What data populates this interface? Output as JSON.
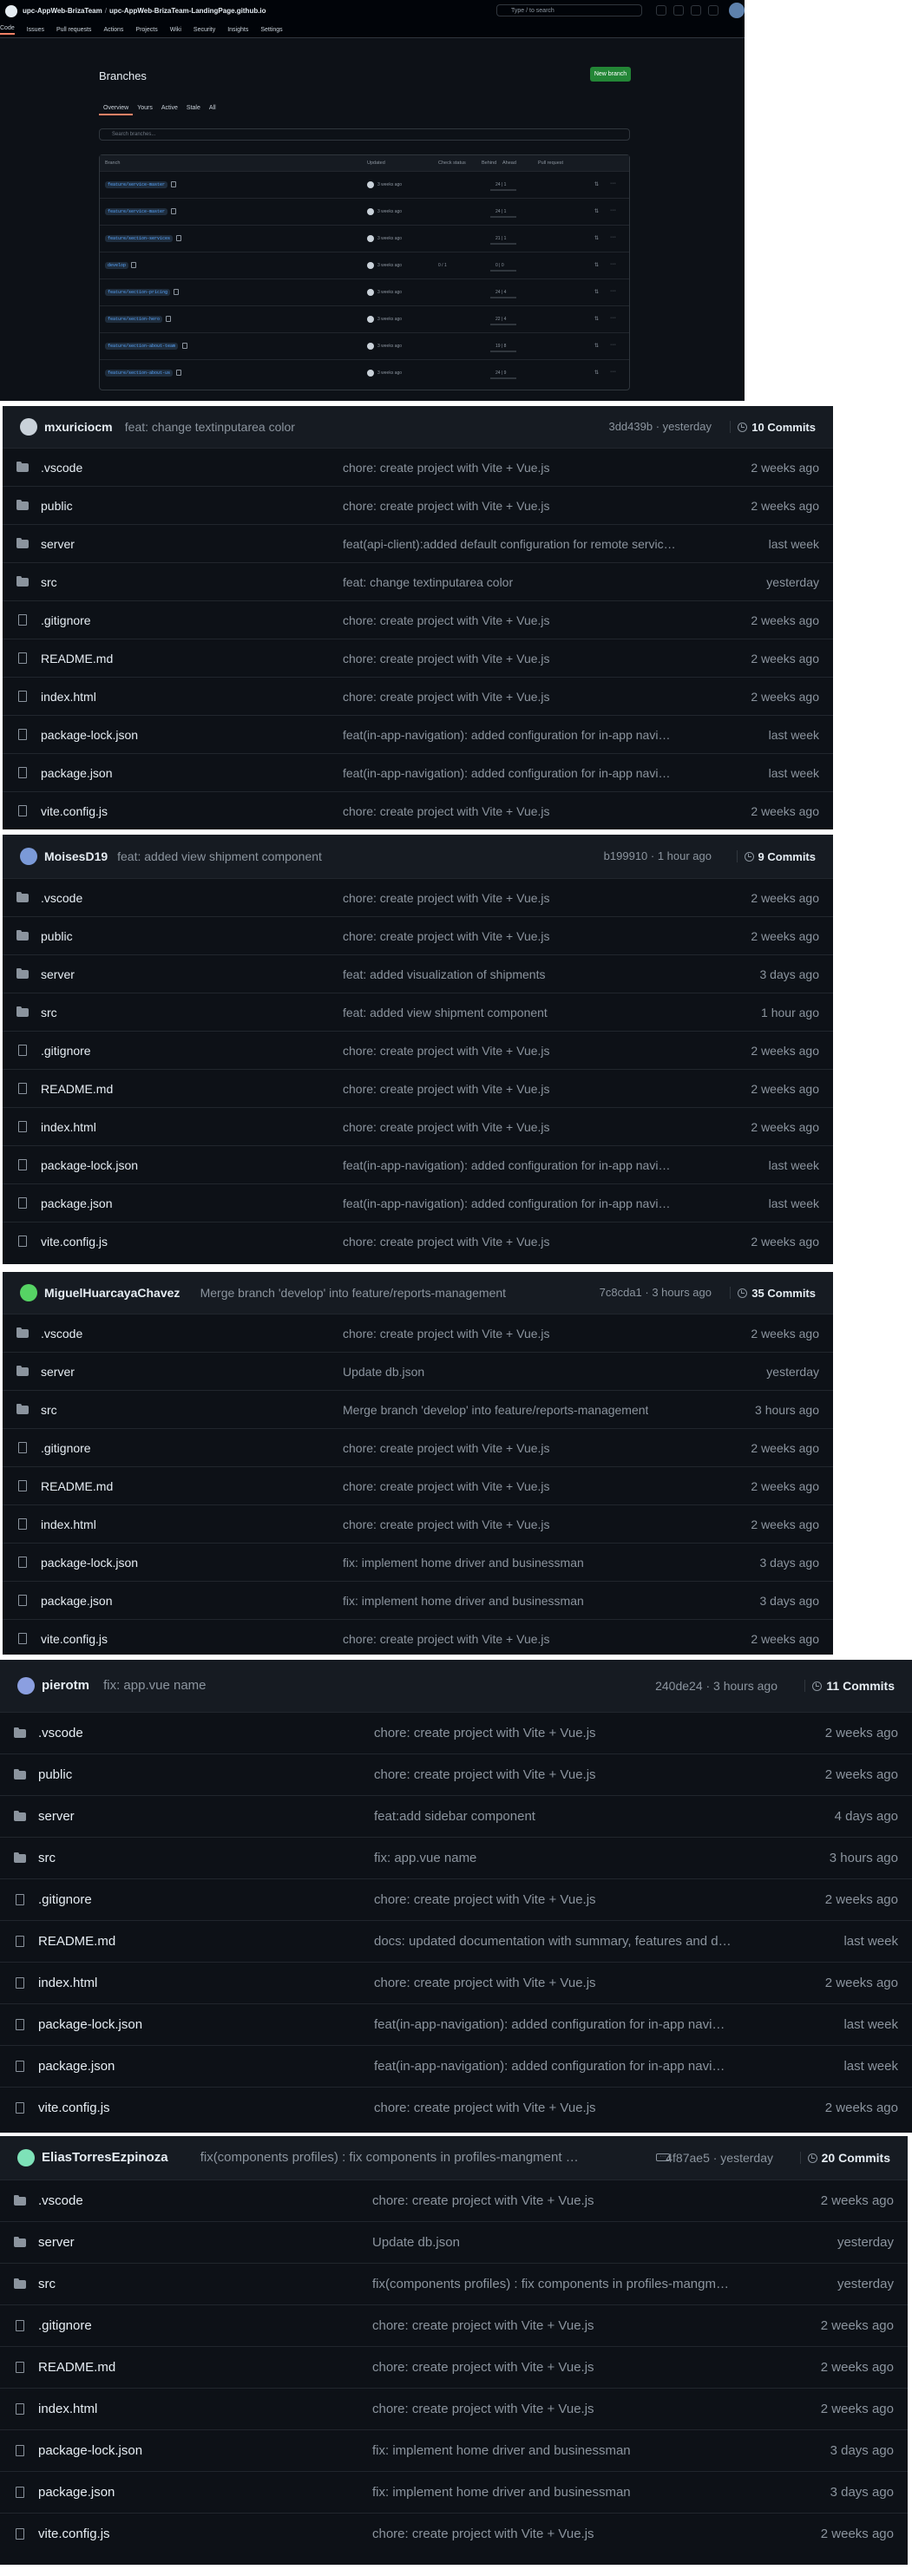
{
  "branches_page": {
    "repo_owner": "upc-AppWeb-BrizaTeam",
    "separator": "/",
    "repo_name": "upc-AppWeb-BrizaTeam-LandingPage.github.io",
    "search_placeholder": "Type / to search",
    "nav": [
      "Code",
      "Issues",
      "Pull requests",
      "Actions",
      "Projects",
      "Wiki",
      "Security",
      "Insights",
      "Settings"
    ],
    "title": "Branches",
    "new_branch_label": "New branch",
    "tabs": [
      "Overview",
      "Yours",
      "Active",
      "Stale",
      "All"
    ],
    "filter_placeholder": "Search branches...",
    "columns": [
      "Branch",
      "Updated",
      "Check status",
      "Behind",
      "Ahead",
      "Pull request"
    ],
    "rows": [
      {
        "name": "feature/service-master",
        "updated": "3 weeks ago",
        "checks": "",
        "ab": "24 | 1"
      },
      {
        "name": "feature/service-master",
        "updated": "3 weeks ago",
        "checks": "",
        "ab": "24 | 1"
      },
      {
        "name": "feature/section-services",
        "updated": "3 weeks ago",
        "checks": "",
        "ab": "21 | 1"
      },
      {
        "name": "develop",
        "updated": "3 weeks ago",
        "checks": "0 / 1",
        "ab": "0 | 0"
      },
      {
        "name": "feature/section-pricing",
        "updated": "3 weeks ago",
        "checks": "",
        "ab": "24 | 4"
      },
      {
        "name": "feature/section-hero",
        "updated": "3 weeks ago",
        "checks": "",
        "ab": "22 | 4"
      },
      {
        "name": "feature/section-about-team",
        "updated": "3 weeks ago",
        "checks": "",
        "ab": "19 | 8"
      },
      {
        "name": "feature/section-about-us",
        "updated": "3 weeks ago",
        "checks": "",
        "ab": "24 | 9"
      }
    ]
  },
  "panels": [
    {
      "author": "mxuriciocm",
      "message": "feat: change textinputarea color",
      "meta": "3dd439b · yesterday",
      "commits_label": "10 Commits",
      "avatar_color": "#c9d1d9",
      "rows": [
        {
          "type": "folder",
          "name": ".vscode",
          "commit": "chore: create project with Vite + Vue.js",
          "time": "2 weeks ago"
        },
        {
          "type": "folder",
          "name": "public",
          "commit": "chore: create project with Vite + Vue.js",
          "time": "2 weeks ago"
        },
        {
          "type": "folder",
          "name": "server",
          "commit": "feat(api-client):added default configuration for remote servic…",
          "time": "last week"
        },
        {
          "type": "folder",
          "name": "src",
          "commit": "feat: change textinputarea color",
          "time": "yesterday"
        },
        {
          "type": "file",
          "name": ".gitignore",
          "commit": "chore: create project with Vite + Vue.js",
          "time": "2 weeks ago"
        },
        {
          "type": "file",
          "name": "README.md",
          "commit": "chore: create project with Vite + Vue.js",
          "time": "2 weeks ago"
        },
        {
          "type": "file",
          "name": "index.html",
          "commit": "chore: create project with Vite + Vue.js",
          "time": "2 weeks ago"
        },
        {
          "type": "file",
          "name": "package-lock.json",
          "commit": "feat(in-app-navigation): added configuration for in-app navi…",
          "time": "last week"
        },
        {
          "type": "file",
          "name": "package.json",
          "commit": "feat(in-app-navigation): added configuration for in-app navi…",
          "time": "last week"
        },
        {
          "type": "file",
          "name": "vite.config.js",
          "commit": "chore: create project with Vite + Vue.js",
          "time": "2 weeks ago"
        }
      ]
    },
    {
      "author": "MoisesD19",
      "message": "feat: added view shipment component",
      "meta": "b199910 · 1 hour ago",
      "commits_label": "9 Commits",
      "avatar_color": "#7b9ad8",
      "rows": [
        {
          "type": "folder",
          "name": ".vscode",
          "commit": "chore: create project with Vite + Vue.js",
          "time": "2 weeks ago"
        },
        {
          "type": "folder",
          "name": "public",
          "commit": "chore: create project with Vite + Vue.js",
          "time": "2 weeks ago"
        },
        {
          "type": "folder",
          "name": "server",
          "commit": "feat: added visualization of shipments",
          "time": "3 days ago"
        },
        {
          "type": "folder",
          "name": "src",
          "commit": "feat: added view shipment component",
          "time": "1 hour ago"
        },
        {
          "type": "file",
          "name": ".gitignore",
          "commit": "chore: create project with Vite + Vue.js",
          "time": "2 weeks ago"
        },
        {
          "type": "file",
          "name": "README.md",
          "commit": "chore: create project with Vite + Vue.js",
          "time": "2 weeks ago"
        },
        {
          "type": "file",
          "name": "index.html",
          "commit": "chore: create project with Vite + Vue.js",
          "time": "2 weeks ago"
        },
        {
          "type": "file",
          "name": "package-lock.json",
          "commit": "feat(in-app-navigation): added configuration for in-app navi…",
          "time": "last week"
        },
        {
          "type": "file",
          "name": "package.json",
          "commit": "feat(in-app-navigation): added configuration for in-app navi…",
          "time": "last week"
        },
        {
          "type": "file",
          "name": "vite.config.js",
          "commit": "chore: create project with Vite + Vue.js",
          "time": "2 weeks ago"
        }
      ]
    },
    {
      "author": "MiguelHuarcayaChavez",
      "message": "Merge branch 'develop' into feature/reports-management",
      "meta": "7c8cda1 · 3 hours ago",
      "commits_label": "35 Commits",
      "avatar_color": "#56d364",
      "rows": [
        {
          "type": "folder",
          "name": ".vscode",
          "commit": "chore: create project with Vite + Vue.js",
          "time": "2 weeks ago"
        },
        {
          "type": "folder",
          "name": "server",
          "commit": "Update db.json",
          "time": "yesterday"
        },
        {
          "type": "folder",
          "name": "src",
          "commit": "Merge branch 'develop' into feature/reports-management",
          "time": "3 hours ago"
        },
        {
          "type": "file",
          "name": ".gitignore",
          "commit": "chore: create project with Vite + Vue.js",
          "time": "2 weeks ago"
        },
        {
          "type": "file",
          "name": "README.md",
          "commit": "chore: create project with Vite + Vue.js",
          "time": "2 weeks ago"
        },
        {
          "type": "file",
          "name": "index.html",
          "commit": "chore: create project with Vite + Vue.js",
          "time": "2 weeks ago"
        },
        {
          "type": "file",
          "name": "package-lock.json",
          "commit": "fix: implement home driver and businessman",
          "time": "3 days ago"
        },
        {
          "type": "file",
          "name": "package.json",
          "commit": "fix: implement home driver and businessman",
          "time": "3 days ago"
        },
        {
          "type": "file",
          "name": "vite.config.js",
          "commit": "chore: create project with Vite + Vue.js",
          "time": "2 weeks ago"
        }
      ]
    },
    {
      "author": "pierotm",
      "message": "fix: app.vue name",
      "meta": "240de24 · 3 hours ago",
      "commits_label": "11 Commits",
      "avatar_color": "#8b9fe0",
      "rows": [
        {
          "type": "folder",
          "name": ".vscode",
          "commit": "chore: create project with Vite + Vue.js",
          "time": "2 weeks ago"
        },
        {
          "type": "folder",
          "name": "public",
          "commit": "chore: create project with Vite + Vue.js",
          "time": "2 weeks ago"
        },
        {
          "type": "folder",
          "name": "server",
          "commit": "feat:add sidebar component",
          "time": "4 days ago"
        },
        {
          "type": "folder",
          "name": "src",
          "commit": "fix: app.vue name",
          "time": "3 hours ago"
        },
        {
          "type": "file",
          "name": ".gitignore",
          "commit": "chore: create project with Vite + Vue.js",
          "time": "2 weeks ago"
        },
        {
          "type": "file",
          "name": "README.md",
          "commit": "docs: updated documentation with summary, features and d…",
          "time": "last week"
        },
        {
          "type": "file",
          "name": "index.html",
          "commit": "chore: create project with Vite + Vue.js",
          "time": "2 weeks ago"
        },
        {
          "type": "file",
          "name": "package-lock.json",
          "commit": "feat(in-app-navigation): added configuration for in-app navi…",
          "time": "last week"
        },
        {
          "type": "file",
          "name": "package.json",
          "commit": "feat(in-app-navigation): added configuration for in-app navi…",
          "time": "last week"
        },
        {
          "type": "file",
          "name": "vite.config.js",
          "commit": "chore: create project with Vite + Vue.js",
          "time": "2 weeks ago"
        }
      ]
    },
    {
      "author": "EliasTorresEzpinoza",
      "message": "fix(components profiles) : fix components in profiles-mangment bou…",
      "meta": "4f87ae5 · yesterday",
      "commits_label": "20 Commits",
      "avatar_color": "#7ee2b8",
      "dots_label": "···",
      "rows": [
        {
          "type": "folder",
          "name": ".vscode",
          "commit": "chore: create project with Vite + Vue.js",
          "time": "2 weeks ago"
        },
        {
          "type": "folder",
          "name": "server",
          "commit": "Update db.json",
          "time": "yesterday"
        },
        {
          "type": "folder",
          "name": "src",
          "commit": "fix(components profiles) : fix components in profiles-mangm…",
          "time": "yesterday"
        },
        {
          "type": "file",
          "name": ".gitignore",
          "commit": "chore: create project with Vite + Vue.js",
          "time": "2 weeks ago"
        },
        {
          "type": "file",
          "name": "README.md",
          "commit": "chore: create project with Vite + Vue.js",
          "time": "2 weeks ago"
        },
        {
          "type": "file",
          "name": "index.html",
          "commit": "chore: create project with Vite + Vue.js",
          "time": "2 weeks ago"
        },
        {
          "type": "file",
          "name": "package-lock.json",
          "commit": "fix: implement home driver and businessman",
          "time": "3 days ago"
        },
        {
          "type": "file",
          "name": "package.json",
          "commit": "fix: implement home driver and businessman",
          "time": "3 days ago"
        },
        {
          "type": "file",
          "name": "vite.config.js",
          "commit": "chore: create project with Vite + Vue.js",
          "time": "2 weeks ago"
        }
      ]
    }
  ]
}
